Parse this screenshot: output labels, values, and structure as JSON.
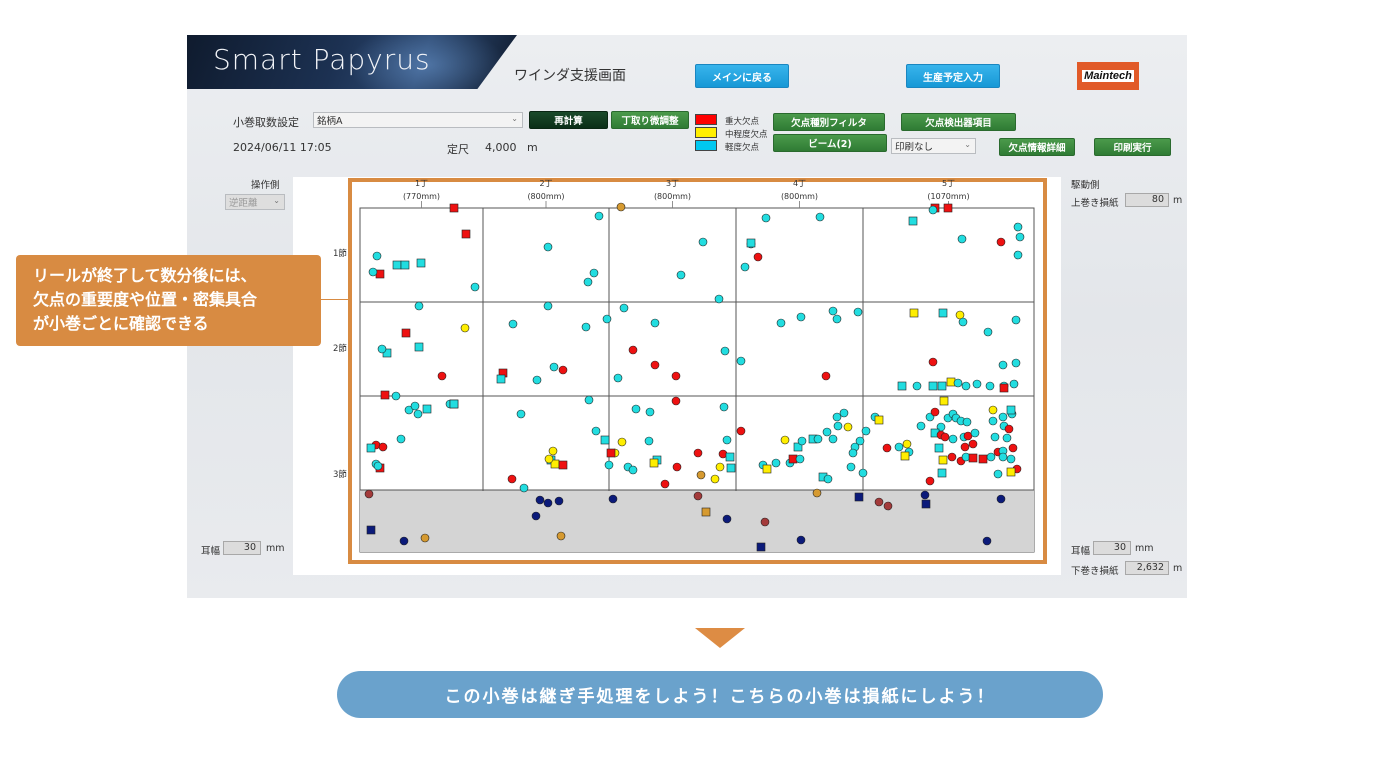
{
  "header": {
    "logo": "Smart Papyrus",
    "screen_title": "ワインダ支援画面",
    "btn_main": "メインに戻る",
    "btn_plan": "生産予定入力",
    "company_logo": "Maintech"
  },
  "controls": {
    "roll_count_label": "小巻取数設定",
    "brand_value": "銘柄A",
    "btn_recalc": "再計算",
    "btn_adjust": "丁取り微調整",
    "datetime": "2024/06/11 17:05",
    "length_label": "定尺",
    "length_value": "4,000",
    "length_unit": "m",
    "legend": [
      {
        "label": "重大欠点",
        "color": "#ff0000"
      },
      {
        "label": "中程度欠点",
        "color": "#ffee00"
      },
      {
        "label": "軽度欠点",
        "color": "#00c8f0"
      }
    ],
    "btn_filter": "欠点種別フィルタ",
    "btn_detector": "欠点検出器項目",
    "btn_beam": "ビーム(2)",
    "print_select": "印刷なし",
    "btn_detail": "欠点情報詳細",
    "btn_print": "印刷実行"
  },
  "left_panel": {
    "side_label": "操作側",
    "side_select": "逆距離",
    "edge_label": "耳幅",
    "edge_value": "30",
    "edge_unit": "mm"
  },
  "right_panel": {
    "side_label": "駆動側",
    "upper_loss_label": "上巻き損紙",
    "upper_loss_value": "80",
    "upper_loss_unit": "m",
    "edge_label": "耳幅",
    "edge_value": "30",
    "edge_unit": "mm",
    "lower_loss_label": "下巻き損紙",
    "lower_loss_value": "2,632",
    "lower_loss_unit": "m"
  },
  "chart": {
    "columns": [
      {
        "label": "1丁",
        "width": "(770mm)"
      },
      {
        "label": "2丁",
        "width": "(800mm)"
      },
      {
        "label": "3丁",
        "width": "(800mm)"
      },
      {
        "label": "4丁",
        "width": "(800mm)"
      },
      {
        "label": "5丁",
        "width": "(1070mm)"
      }
    ],
    "rows": [
      "1節",
      "2節",
      "3節"
    ],
    "colors": {
      "major": "#ee1111",
      "medium": "#ffee00",
      "minor": "#22dde0",
      "other_orange": "#d69a30",
      "other_darkred": "#a33a3a",
      "other_navy": "#0b1a7a",
      "frame": "#d88b42"
    }
  },
  "callout": {
    "lines": [
      "リールが終了して数分後には、",
      "欠点の重要度や位置・密集具合",
      "が小巻ごとに確認できる"
    ]
  },
  "bottom_message": "この小巻は継ぎ手処理をしよう！こちらの小巻は損紙にしよう！"
}
